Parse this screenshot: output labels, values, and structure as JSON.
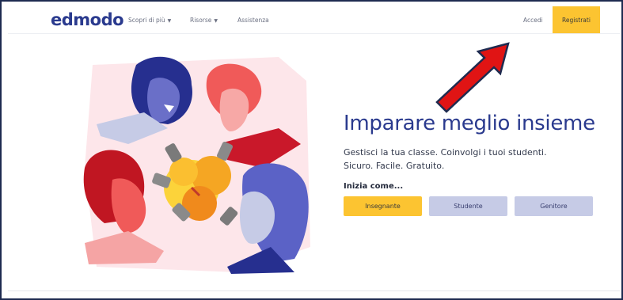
{
  "header": {
    "logo": "edmodo",
    "nav": {
      "discover": "Scopri di più",
      "resources": "Risorse",
      "help": "Assistenza"
    },
    "login": "Accedi",
    "signup": "Registrati"
  },
  "hero": {
    "headline": "Imparare meglio insieme",
    "tagline_line1": "Gestisci la tua classe. Coinvolgi i tuoi studenti.",
    "tagline_line2": "Sicuro. Facile. Gratuito.",
    "start_as": "Inizia come...",
    "roles": {
      "teacher": "Insegnante",
      "student": "Studente",
      "parent": "Genitore"
    }
  },
  "colors": {
    "brand_blue": "#2a3a8e",
    "accent_yellow": "#fcc431",
    "secondary_button": "#c6cbe6",
    "annotation_red": "#e01414"
  }
}
